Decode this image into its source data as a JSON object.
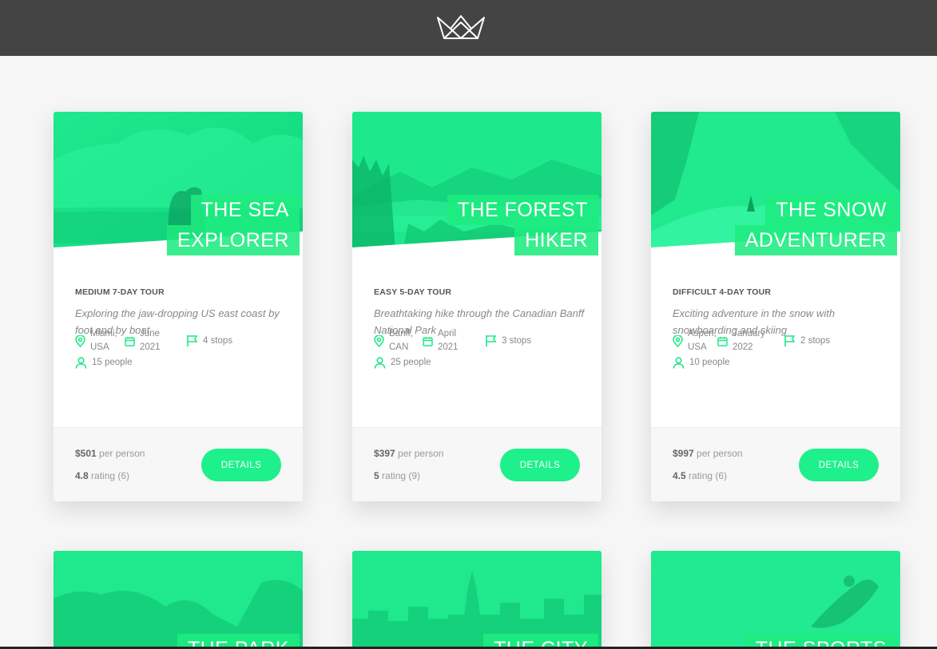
{
  "header": {
    "logo_icon": "crown-logo-icon"
  },
  "colors": {
    "accent": "#1ef08b",
    "header_bg": "#444444",
    "page_bg": "#f6f6f6"
  },
  "tours": [
    {
      "title_line1": "THE SEA",
      "title_line2": "EXPLORER",
      "sub_heading": "MEDIUM 7-DAY TOUR",
      "summary": "Exploring the jaw-dropping US east coast by foot and by boat",
      "location_line1": "Miami,",
      "location_line2": "USA",
      "date_line1": "June",
      "date_line2": "2021",
      "stops": "4 stops",
      "people": "15 people",
      "price": "$501",
      "price_unit": "per person",
      "rating": "4.8",
      "rating_text": "rating (6)",
      "button": "DETAILS"
    },
    {
      "title_line1": "THE FOREST",
      "title_line2": "HIKER",
      "sub_heading": "EASY 5-DAY TOUR",
      "summary": "Breathtaking hike through the Canadian Banff National Park",
      "location_line1": "Banff,",
      "location_line2": "CAN",
      "date_line1": "April",
      "date_line2": "2021",
      "stops": "3 stops",
      "people": "25 people",
      "price": "$397",
      "price_unit": "per person",
      "rating": "5",
      "rating_text": "rating (9)",
      "button": "DETAILS"
    },
    {
      "title_line1": "THE SNOW",
      "title_line2": "ADVENTURER",
      "sub_heading": "DIFFICULT 4-DAY TOUR",
      "summary": "Exciting adventure in the snow with snowboarding and skiing",
      "location_line1": "Aspen,",
      "location_line2": "USA",
      "date_line1": "January",
      "date_line2": "2022",
      "stops": "2 stops",
      "people": "10 people",
      "price": "$997",
      "price_unit": "per person",
      "rating": "4.5",
      "rating_text": "rating (6)",
      "button": "DETAILS"
    }
  ],
  "partial_tours": [
    {
      "title_line1": "THE PARK"
    },
    {
      "title_line1": "THE CITY"
    },
    {
      "title_line1": "THE SPORTS"
    }
  ]
}
